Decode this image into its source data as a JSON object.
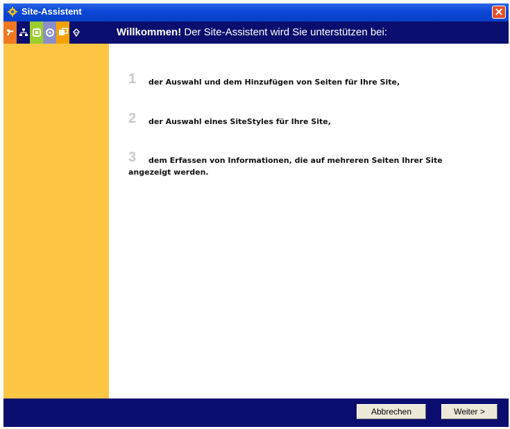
{
  "window": {
    "title": "Site-Assistent",
    "title_icon": "gear-icon"
  },
  "header": {
    "steps": [
      {
        "icon": "welcome-icon",
        "color": "#f07820"
      },
      {
        "icon": "sitemap-icon",
        "color": "#0b0e6e"
      },
      {
        "icon": "style-icon",
        "color": "#9bcd2d"
      },
      {
        "icon": "info-icon",
        "color": "#8a8fc8"
      },
      {
        "icon": "pages-icon",
        "color": "#f5a200"
      },
      {
        "icon": "finish-icon",
        "color": "#0b0e6e"
      }
    ],
    "title_bold": "Willkommen!",
    "title_rest": " Der Site-Assistent wird Sie unterstützen bei:"
  },
  "items": [
    {
      "number": "1",
      "text": "der Auswahl und dem Hinzufügen von Seiten für Ihre Site,"
    },
    {
      "number": "2",
      "text": "der Auswahl eines SiteStyles für Ihre Site,"
    },
    {
      "number": "3",
      "text": "dem Erfassen von Informationen, die auf mehreren Seiten Ihrer Site angezeigt werden."
    }
  ],
  "footer": {
    "cancel_label": "Abbrechen",
    "next_label": "Weiter >"
  },
  "colors": {
    "titlebar": "#0a46d6",
    "header": "#0b0e6e",
    "sidebar": "#fdc544"
  }
}
